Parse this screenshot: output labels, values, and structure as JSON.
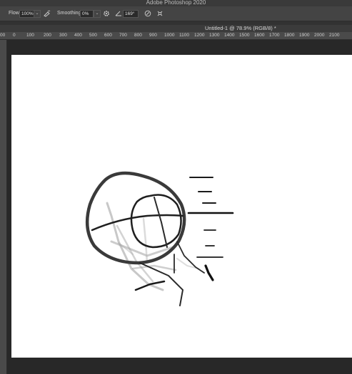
{
  "app": {
    "title": "Adobe Photoshop 2020"
  },
  "options": {
    "flow_label": "Flow:",
    "flow_value": "100%",
    "smoothing_label": "Smoothing:",
    "smoothing_value": "0%",
    "angle_value": "169°"
  },
  "document": {
    "tab_title": "Untitled-1 @ 78.9% (RGB/8) *"
  },
  "ruler": {
    "ticks": [
      "00",
      "0",
      "100",
      "200",
      "300",
      "400",
      "500",
      "600",
      "700",
      "800",
      "900",
      "1000",
      "1100",
      "1200",
      "1300",
      "1400",
      "1500",
      "1600",
      "1700",
      "1800",
      "1900",
      "2000",
      "2100"
    ]
  },
  "colors": {
    "canvas": "#ffffff",
    "workspace": "#282828",
    "stroke": "#1e1e1e"
  }
}
